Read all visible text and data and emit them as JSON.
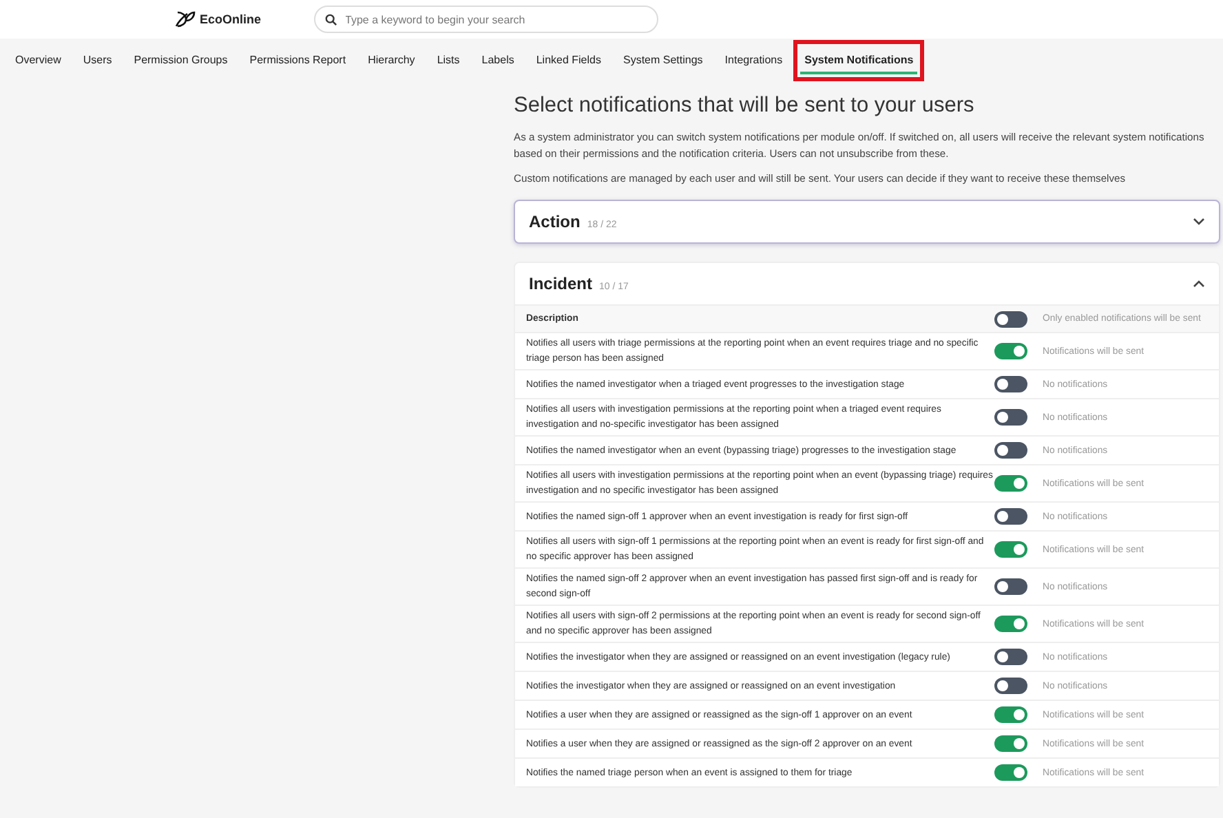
{
  "header": {
    "logo_text": "EcoOnline",
    "search": {
      "placeholder": "Type a keyword to begin your search"
    }
  },
  "tabs": [
    {
      "label": "Overview",
      "selected": false,
      "highlighted": false
    },
    {
      "label": "Users",
      "selected": false,
      "highlighted": false
    },
    {
      "label": "Permission Groups",
      "selected": false,
      "highlighted": false
    },
    {
      "label": "Permissions Report",
      "selected": false,
      "highlighted": false
    },
    {
      "label": "Hierarchy",
      "selected": false,
      "highlighted": false
    },
    {
      "label": "Lists",
      "selected": false,
      "highlighted": false
    },
    {
      "label": "Labels",
      "selected": false,
      "highlighted": false
    },
    {
      "label": "Linked Fields",
      "selected": false,
      "highlighted": false
    },
    {
      "label": "System Settings",
      "selected": false,
      "highlighted": false
    },
    {
      "label": "Integrations",
      "selected": false,
      "highlighted": false
    },
    {
      "label": "System Notifications",
      "selected": true,
      "highlighted": true
    }
  ],
  "title": "Select notifications that will be sent to your users",
  "intro": [
    "As a system administrator you can switch system notifications per module on/off. If switched on, all users will receive the relevant system notifications based on their permissions and the notification criteria. Users can not unsubscribe from these.",
    "Custom notifications are managed by each user and will still be sent. Your users can decide if they want to receive these themselves"
  ],
  "modules": [
    {
      "name": "Action",
      "count": "18 / 22",
      "expanded": false,
      "focused": true
    },
    {
      "name": "Incident",
      "count": "10 / 17",
      "expanded": true,
      "focused": false,
      "table": {
        "column": "Description",
        "master": {
          "on": false,
          "status": "Only enabled notifications will be sent"
        },
        "rows": [
          {
            "description": "Notifies all users with triage permissions at the reporting point when an event requires triage and no specific triage person has been assigned",
            "on": true,
            "status": "Notifications will be sent"
          },
          {
            "description": "Notifies the named investigator when a triaged event progresses to the investigation stage",
            "on": false,
            "status": "No notifications"
          },
          {
            "description": "Notifies all users with investigation permissions at the reporting point when a triaged event requires investigation and no-specific investigator has been assigned",
            "on": false,
            "status": "No notifications"
          },
          {
            "description": "Notifies the named investigator when an event (bypassing triage) progresses to the investigation stage",
            "on": false,
            "status": "No notifications"
          },
          {
            "description": "Notifies all users with investigation permissions at the reporting point when an event (bypassing triage) requires investigation and no specific investigator has been assigned",
            "on": true,
            "status": "Notifications will be sent"
          },
          {
            "description": "Notifies the named sign-off 1 approver when an event investigation is ready for first sign-off",
            "on": false,
            "status": "No notifications"
          },
          {
            "description": "Notifies all users with sign-off 1 permissions at the reporting point when an event is ready for first sign-off and no specific approver has been assigned",
            "on": true,
            "status": "Notifications will be sent"
          },
          {
            "description": "Notifies the named sign-off 2 approver when an event investigation has passed first sign-off and is ready for second sign-off",
            "on": false,
            "status": "No notifications"
          },
          {
            "description": "Notifies all users with sign-off 2 permissions at the reporting point when an event is ready for second sign-off and no specific approver has been assigned",
            "on": true,
            "status": "Notifications will be sent"
          },
          {
            "description": "Notifies the investigator when they are assigned or reassigned on an event investigation (legacy rule)",
            "on": false,
            "status": "No notifications"
          },
          {
            "description": "Notifies the investigator when they are assigned or reassigned on an event investigation",
            "on": false,
            "status": "No notifications"
          },
          {
            "description": "Notifies a user when they are assigned or reassigned as the sign-off 1 approver on an event",
            "on": true,
            "status": "Notifications will be sent"
          },
          {
            "description": "Notifies a user when they are assigned or reassigned as the sign-off 2 approver on an event",
            "on": true,
            "status": "Notifications will be sent"
          },
          {
            "description": "Notifies the named triage person when an event is assigned to them for triage",
            "on": true,
            "status": "Notifications will be sent"
          }
        ]
      }
    }
  ]
}
